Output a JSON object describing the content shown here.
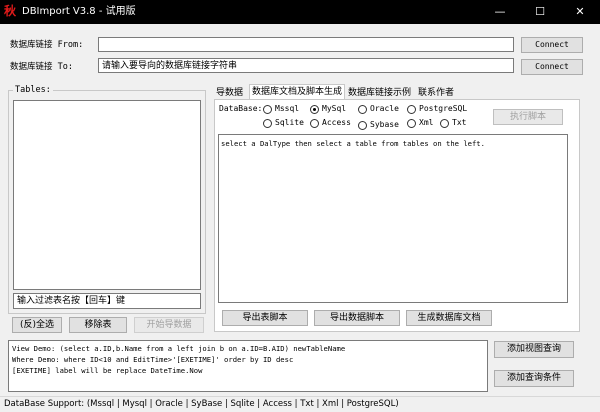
{
  "window": {
    "title": "DBImport V3.8 - 试用版",
    "icon_glyph": "秋",
    "minimize": "—",
    "maximize": "☐",
    "close": "✕"
  },
  "connection": {
    "from_label": "数据库链接 From:",
    "from_value": "",
    "to_label": "数据库链接 To:",
    "to_value": "请输入要导向的数据库链接字符串",
    "connect_from": "Connect",
    "connect_to": "Connect"
  },
  "tables_panel": {
    "legend": "Tables:",
    "filter_value": "输入过滤表名按【回车】键",
    "select_all": "(反)全选",
    "remove_table": "移除表",
    "start_import": "开始导数据"
  },
  "tabs": [
    {
      "label": "导数据"
    },
    {
      "label": "数据库文档及脚本生成"
    },
    {
      "label": "数据库链接示例"
    },
    {
      "label": "联系作者"
    }
  ],
  "database": {
    "label": "DataBase:",
    "options": [
      {
        "label": "Mssql"
      },
      {
        "label": "MySql"
      },
      {
        "label": "Oracle"
      },
      {
        "label": "PostgreSQL"
      },
      {
        "label": "Sqlite"
      },
      {
        "label": "Access"
      },
      {
        "label": "Sybase"
      },
      {
        "label": "Xml"
      },
      {
        "label": "Txt"
      }
    ],
    "selected": "MySql",
    "run_script": "执行脚本"
  },
  "script_area": {
    "text": "select a DalType then select a table from tables on the left."
  },
  "doc_buttons": {
    "export_table_script": "导出表脚本",
    "export_data_script": "导出数据脚本",
    "generate_doc": "生成数据库文档"
  },
  "demo_area": {
    "lines": [
      "View  Demo: (select a.ID,b.Name from a left join b on a.ID=B.AID) newTableName",
      "Where Demo: where ID<10 and EditTime>'[EXETIME]' order by ID desc",
      "[EXETIME] label will be replace DateTime.Now"
    ],
    "add_view_query": "添加视图查询",
    "add_query_condition": "添加查询条件"
  },
  "status_bar": {
    "text": "DataBase Support:    (Mssql | Mysql | Oracle | SyBase | Sqlite | Access | Txt | Xml | PostgreSQL)"
  },
  "colors": {
    "titlebar": "#000000",
    "icon": "#e21a1a",
    "background": "#f0f0f0",
    "button": "#e1e1e1"
  }
}
